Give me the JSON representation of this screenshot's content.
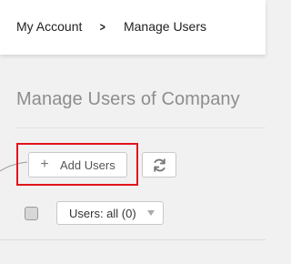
{
  "breadcrumb": {
    "items": [
      {
        "label": "My Account"
      },
      {
        "label": "Manage Users"
      }
    ],
    "separator": ">"
  },
  "page": {
    "title": "Manage Users of Company"
  },
  "toolbar": {
    "add_users_icon": "+",
    "add_users_label": "Add Users",
    "refresh_icon": "refresh-icon"
  },
  "list_controls": {
    "select_all_checked": false,
    "users_filter_label": "Users: all (0)",
    "users_filter_icon": "caret-down-icon"
  },
  "colors": {
    "highlight": "#e0161c",
    "title_text": "#8d8d8d",
    "background": "#f1f1f1"
  }
}
